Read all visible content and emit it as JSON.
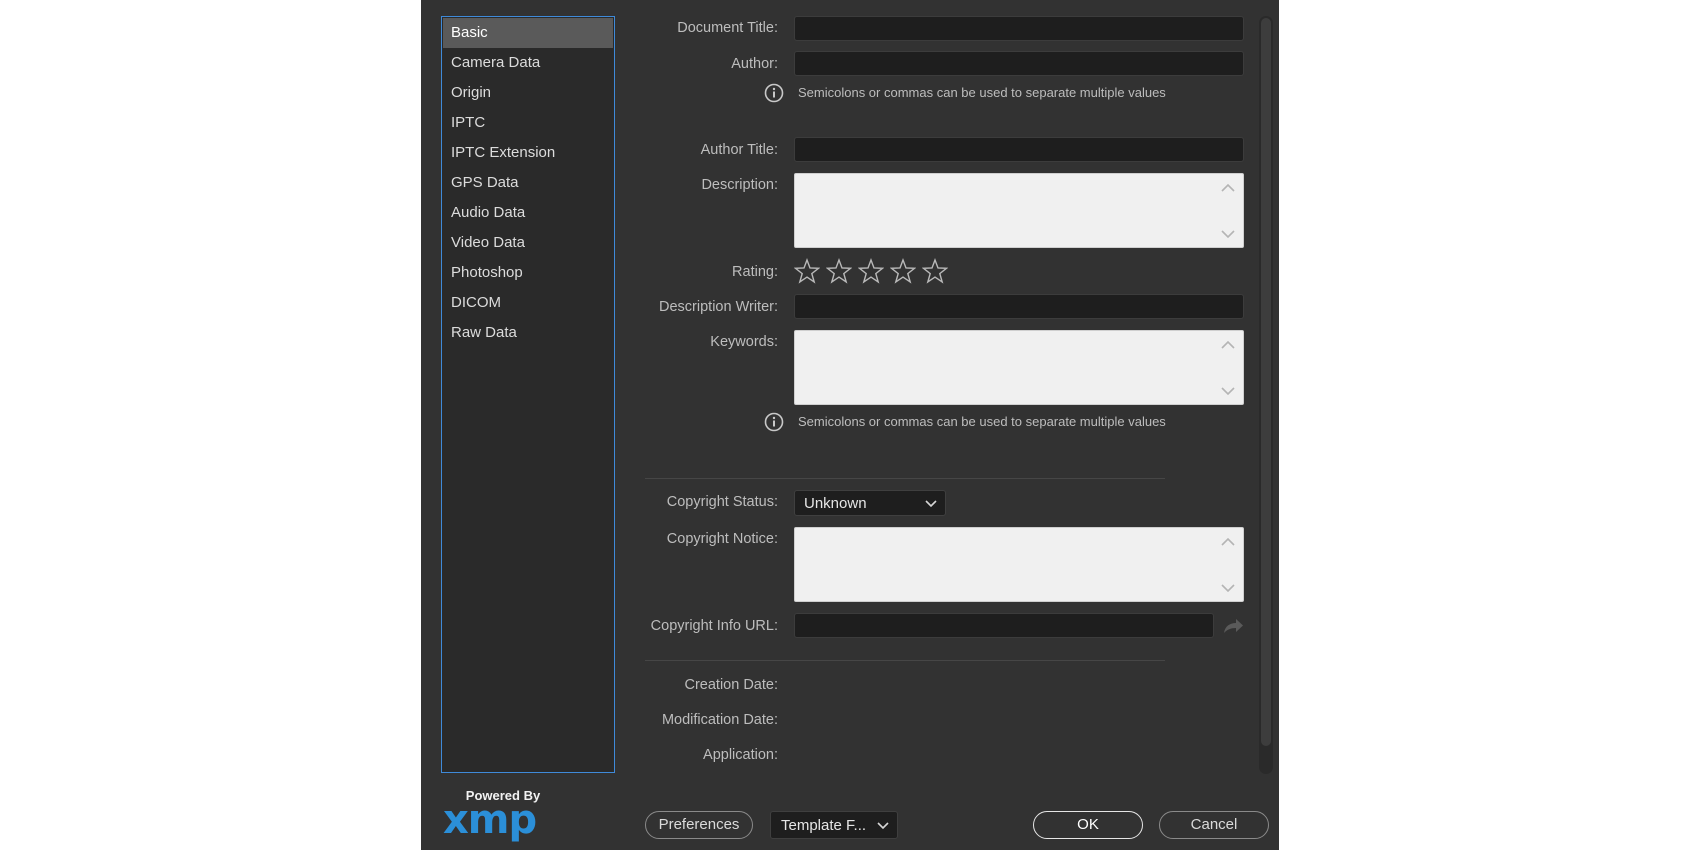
{
  "sidebar": {
    "items": [
      {
        "label": "Basic"
      },
      {
        "label": "Camera Data"
      },
      {
        "label": "Origin"
      },
      {
        "label": "IPTC"
      },
      {
        "label": "IPTC Extension"
      },
      {
        "label": "GPS Data"
      },
      {
        "label": "Audio Data"
      },
      {
        "label": "Video Data"
      },
      {
        "label": "Photoshop"
      },
      {
        "label": "DICOM"
      },
      {
        "label": "Raw Data"
      }
    ],
    "selected": "Basic"
  },
  "branding": {
    "powered_by": "Powered By",
    "logo": "xmp"
  },
  "form": {
    "document_title_label": "Document Title:",
    "author_label": "Author:",
    "author_hint": "Semicolons or commas can be used to separate multiple values",
    "author_title_label": "Author Title:",
    "description_label": "Description:",
    "rating_label": "Rating:",
    "rating_value": 0,
    "rating_max": 5,
    "description_writer_label": "Description Writer:",
    "keywords_label": "Keywords:",
    "keywords_hint": "Semicolons or commas can be used to separate multiple values",
    "copyright_status_label": "Copyright Status:",
    "copyright_status_value": "Unknown",
    "copyright_notice_label": "Copyright Notice:",
    "copyright_url_label": "Copyright Info URL:",
    "creation_date_label": "Creation Date:",
    "modification_date_label": "Modification Date:",
    "application_label": "Application:"
  },
  "footer": {
    "preferences": "Preferences",
    "template": "Template F...",
    "ok": "OK",
    "cancel": "Cancel"
  },
  "colors": {
    "dialog_bg": "#323232",
    "accent": "#3f8ad9",
    "logo": "#2b8fd8"
  }
}
